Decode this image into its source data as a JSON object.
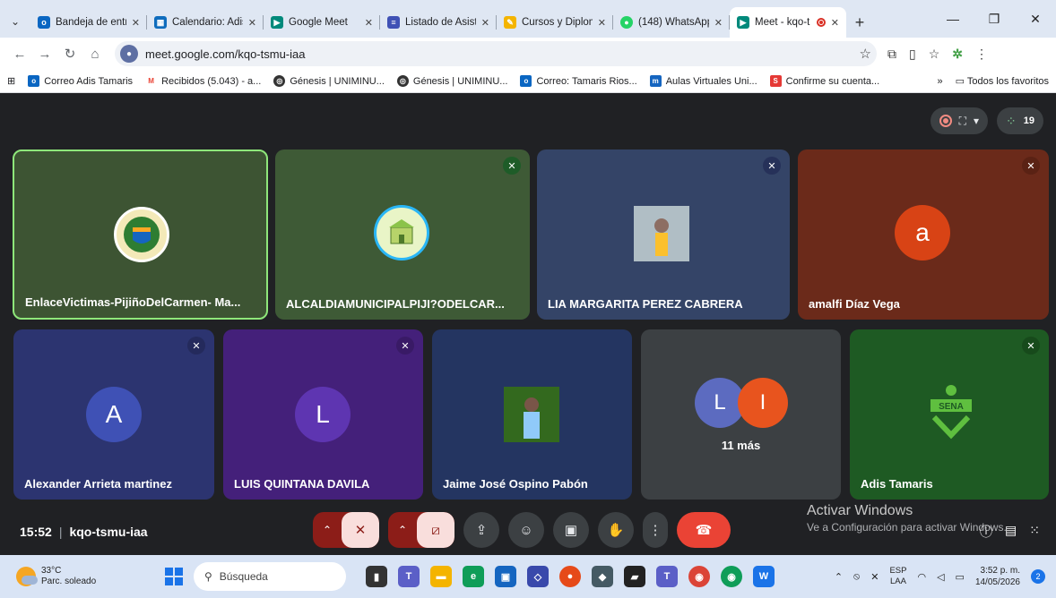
{
  "browser": {
    "tabs": [
      {
        "title": "Bandeja de entra",
        "favicon": "outlook-icon",
        "color": "#0a66c2"
      },
      {
        "title": "Calendario: Adis",
        "favicon": "calendar-icon",
        "color": "#0f6cbd"
      },
      {
        "title": "Google Meet",
        "favicon": "meet-icon",
        "color": "#00897b"
      },
      {
        "title": "Listado de Asiste",
        "favicon": "forms-icon",
        "color": "#3f51b5"
      },
      {
        "title": "Cursos y Diplom",
        "favicon": "pen-icon",
        "color": "#f4b400"
      },
      {
        "title": "(148) WhatsApp",
        "favicon": "whatsapp-icon",
        "color": "#25d366"
      },
      {
        "title": "Meet - kqo-t",
        "favicon": "meet-icon",
        "color": "#00897b",
        "active": true
      }
    ],
    "url": "meet.google.com/kqo-tsmu-iaa",
    "bookmarks": [
      {
        "label": "Correo Adis Tamaris",
        "color": "#0a66c2"
      },
      {
        "label": "Recibidos (5.043) - a...",
        "color": "#ea4335",
        "icon": "M"
      },
      {
        "label": "Génesis | UNIMINU...",
        "color": "#333"
      },
      {
        "label": "Génesis | UNIMINU...",
        "color": "#333"
      },
      {
        "label": "Correo: Tamaris Rios...",
        "color": "#0a66c2"
      },
      {
        "label": "Aulas Virtuales Uni...",
        "color": "#1565c0"
      },
      {
        "label": "Confirme su cuenta...",
        "color": "#e53935",
        "icon": "S"
      }
    ],
    "bookmarks_more": "»",
    "all_bookmarks": "Todos los favoritos"
  },
  "meet": {
    "participant_count": "19",
    "tiles": [
      {
        "name": "EnlaceVictimas-PijiñoDelCarmen- Ma...",
        "bg": "#3d5433",
        "speaking": true,
        "avatar": "logo-seal"
      },
      {
        "name": "ALCALDIAMUNICIPALPIJI?ODELCAR...",
        "bg": "#3e5a36",
        "muted": true,
        "avatar": "logo-building"
      },
      {
        "name": "LIA MARGARITA PEREZ CABRERA",
        "bg": "#344467",
        "muted": true,
        "avatar": "photo"
      },
      {
        "name": "amalfi Díaz Vega",
        "bg": "#6b2a1a",
        "muted": true,
        "avatar": "a",
        "avatar_color": "#d84315"
      },
      {
        "name": "Alexander Arrieta martinez",
        "bg": "#2c3470",
        "muted": true,
        "avatar": "A",
        "avatar_color": "#3f51b5"
      },
      {
        "name": "LUIS QUINTANA DAVILA",
        "bg": "#44207a",
        "muted": true,
        "avatar": "L",
        "avatar_color": "#5e35b1"
      },
      {
        "name": "Jaime José Ospino Pabón",
        "bg": "#243561",
        "avatar": "photo"
      },
      {
        "name": "11 más",
        "bg": "#3c4043",
        "avatars": [
          "L",
          "I"
        ],
        "avatar_colors": [
          "#5c6bc0",
          "#e8541e"
        ]
      },
      {
        "name": "Adis Tamaris",
        "bg": "#1e5a23",
        "muted": true,
        "avatar": "sena-logo"
      }
    ],
    "time": "15:52",
    "code": "kqo-tsmu-iaa",
    "watermark_title": "Activar Windows",
    "watermark_sub": "Ve a Configuración para activar Windows."
  },
  "taskbar": {
    "temperature": "33°C",
    "weather": "Parc. soleado",
    "search_placeholder": "Búsqueda",
    "lang1": "ESP",
    "lang2": "LAA",
    "time": "3:52 p. m.",
    "date": "14/05/2026",
    "notifications": "2"
  }
}
